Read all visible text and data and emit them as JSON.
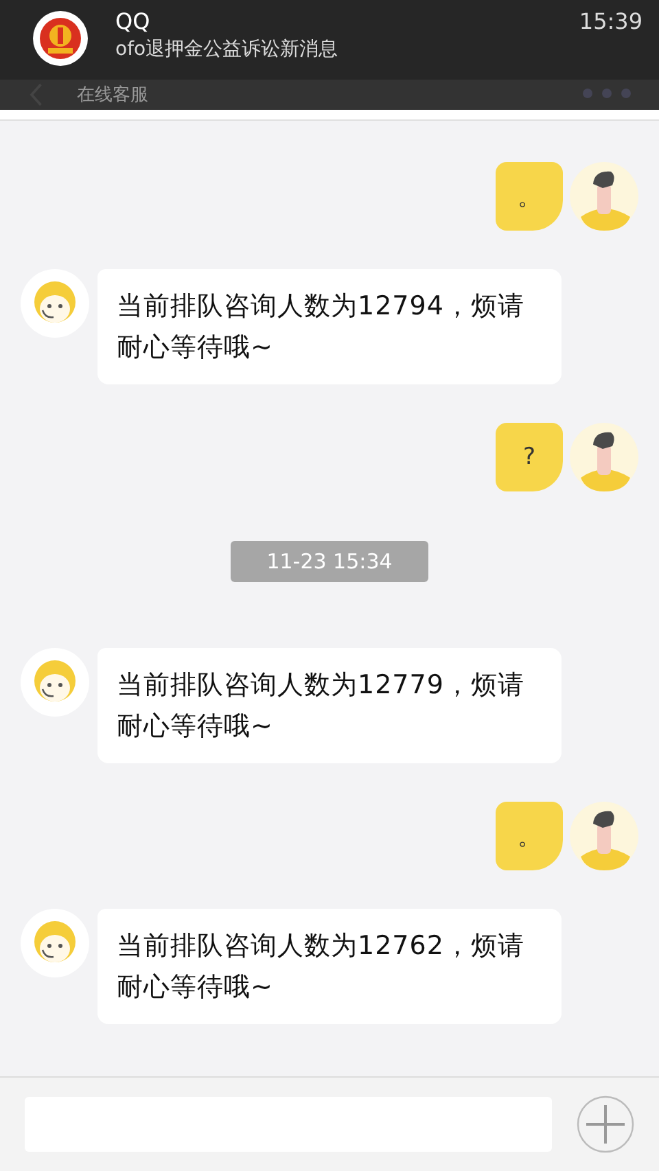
{
  "notification": {
    "app": "QQ",
    "text": "ofo退押金公益诉讼新消息",
    "time": "15:39"
  },
  "header": {
    "title": "在线客服"
  },
  "messages": [
    {
      "kind": "user",
      "text": "。"
    },
    {
      "kind": "bot",
      "text": "当前排队咨询人数为12794，烦请耐心等待哦~"
    },
    {
      "kind": "user",
      "text": "?"
    },
    {
      "kind": "time",
      "text": "11-23 15:34"
    },
    {
      "kind": "bot",
      "text": "当前排队咨询人数为12779，烦请耐心等待哦~"
    },
    {
      "kind": "user",
      "text": "。"
    },
    {
      "kind": "bot",
      "text": "当前排队咨询人数为12762，烦请耐心等待哦~"
    }
  ]
}
